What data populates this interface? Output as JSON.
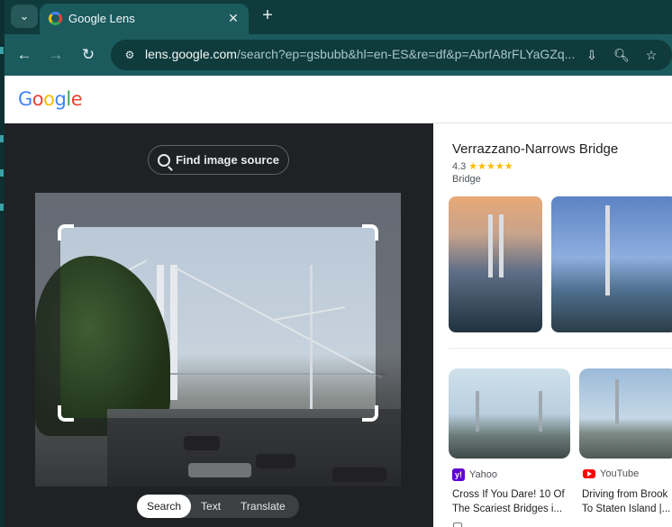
{
  "browser": {
    "tab": {
      "title": "Google Lens",
      "favicon": "google-lens-icon"
    },
    "new_tab": "+",
    "url_host": "lens.google.com",
    "url_rest": "/search?ep=gsbubb&hl=en-ES&re=df&p=AbrfA8rFLYaGZq..."
  },
  "header": {
    "logo": {
      "G": "G",
      "o1": "o",
      "o2": "o",
      "g": "g",
      "l": "l",
      "e": "e"
    }
  },
  "lens": {
    "find_source_label": "Find image source",
    "modes": [
      "Search",
      "Text",
      "Translate"
    ],
    "active_mode": "Search"
  },
  "knowledge_panel": {
    "title": "Verrazzano-Narrows Bridge",
    "rating": "4.3",
    "stars": "★★★★★",
    "type": "Bridge"
  },
  "results": [
    {
      "source": "Yahoo",
      "title_line1": "Cross If You Dare! 10 Of",
      "title_line2": "The Scariest Bridges i..."
    },
    {
      "source": "YouTube",
      "title_line1": "Driving from Brook",
      "title_line2": "To Staten Island |..."
    }
  ],
  "colors": {
    "accent": "#1b5b5e",
    "tabstrip": "#0f3b3d",
    "lens_bg": "#202124"
  }
}
